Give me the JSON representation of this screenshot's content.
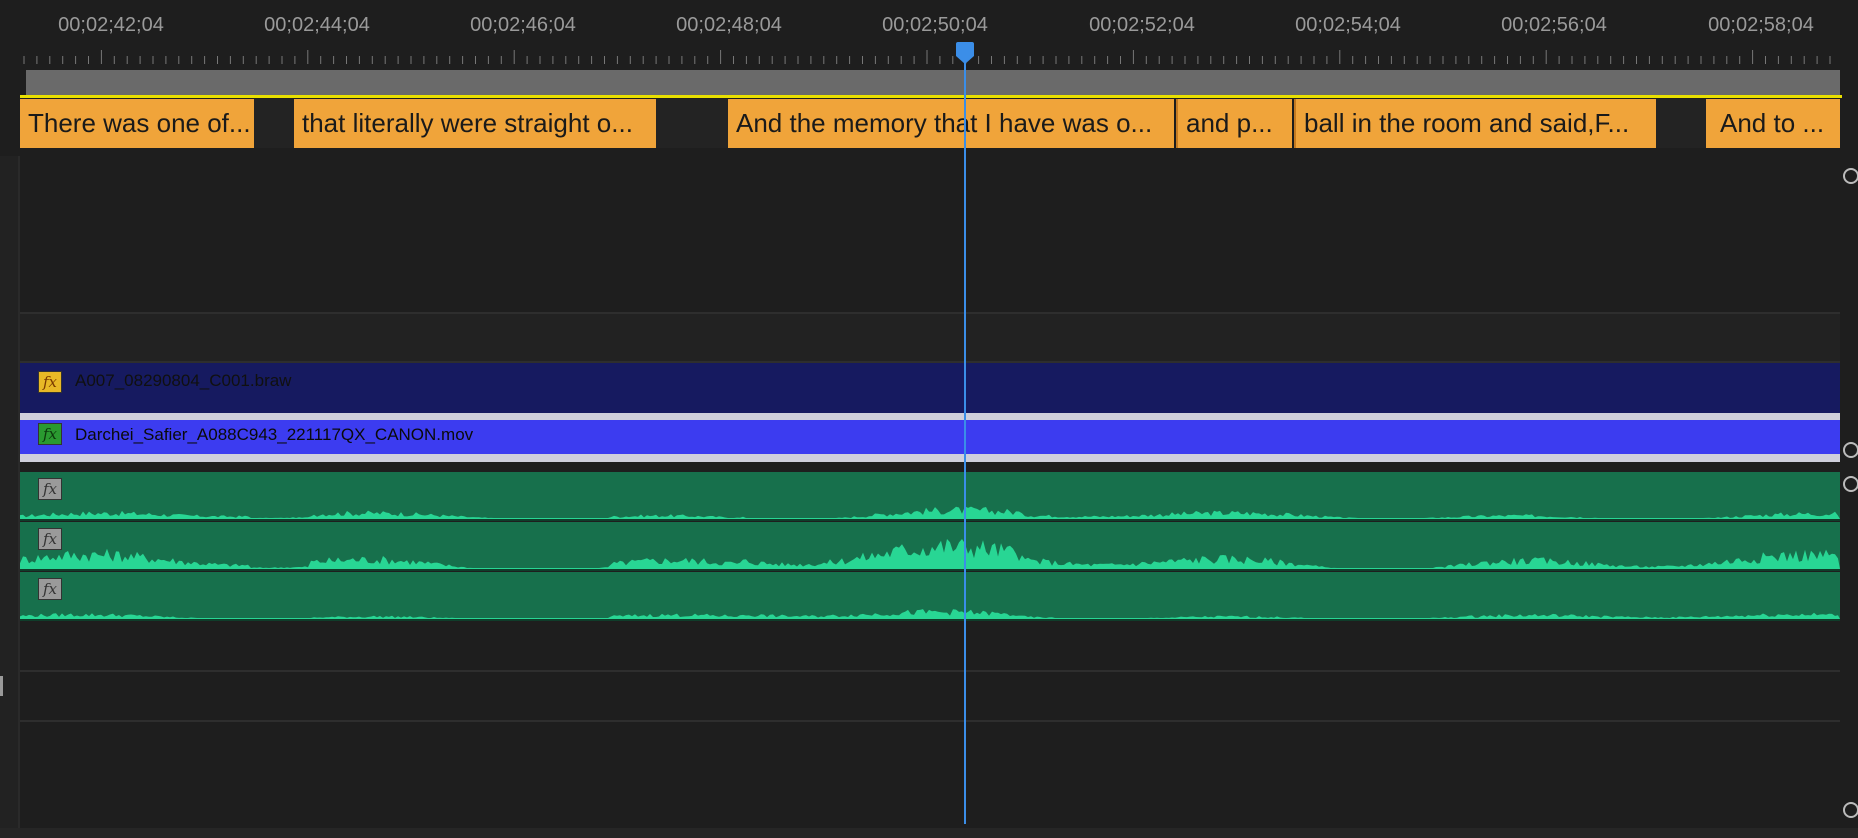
{
  "timeline": {
    "timecodes": [
      "00;02;42;04",
      "00;02;44;04",
      "00;02;46;04",
      "00;02;48;04",
      "00;02;50;04",
      "00;02;52;04",
      "00;02;54;04",
      "00;02;56;04",
      "00;02;58;04"
    ],
    "playhead_timecode_near": "00;02;50;04"
  },
  "captions": [
    "There was one of...",
    "that literally were straight o...",
    "And the memory that I have was o...",
    "and p...",
    "ball in the room and said,F...",
    "And to ..."
  ],
  "video_clips": {
    "clip1": {
      "name": "A007_08290804_C001.braw",
      "fx": "fx"
    },
    "clip2": {
      "name": "Darchei_Safier_A088C943_221117QX_CANON.mov",
      "fx": "fx"
    }
  },
  "audio_clips": [
    {
      "fx": "fx"
    },
    {
      "fx": "fx"
    },
    {
      "fx": "fx"
    }
  ],
  "colors": {
    "caption": "#f0a43a",
    "clip1": "#161a60",
    "clip2": "#3c3cf0",
    "audio": "#17704c",
    "waveform": "#28d694",
    "playhead": "#3b8ee8"
  }
}
